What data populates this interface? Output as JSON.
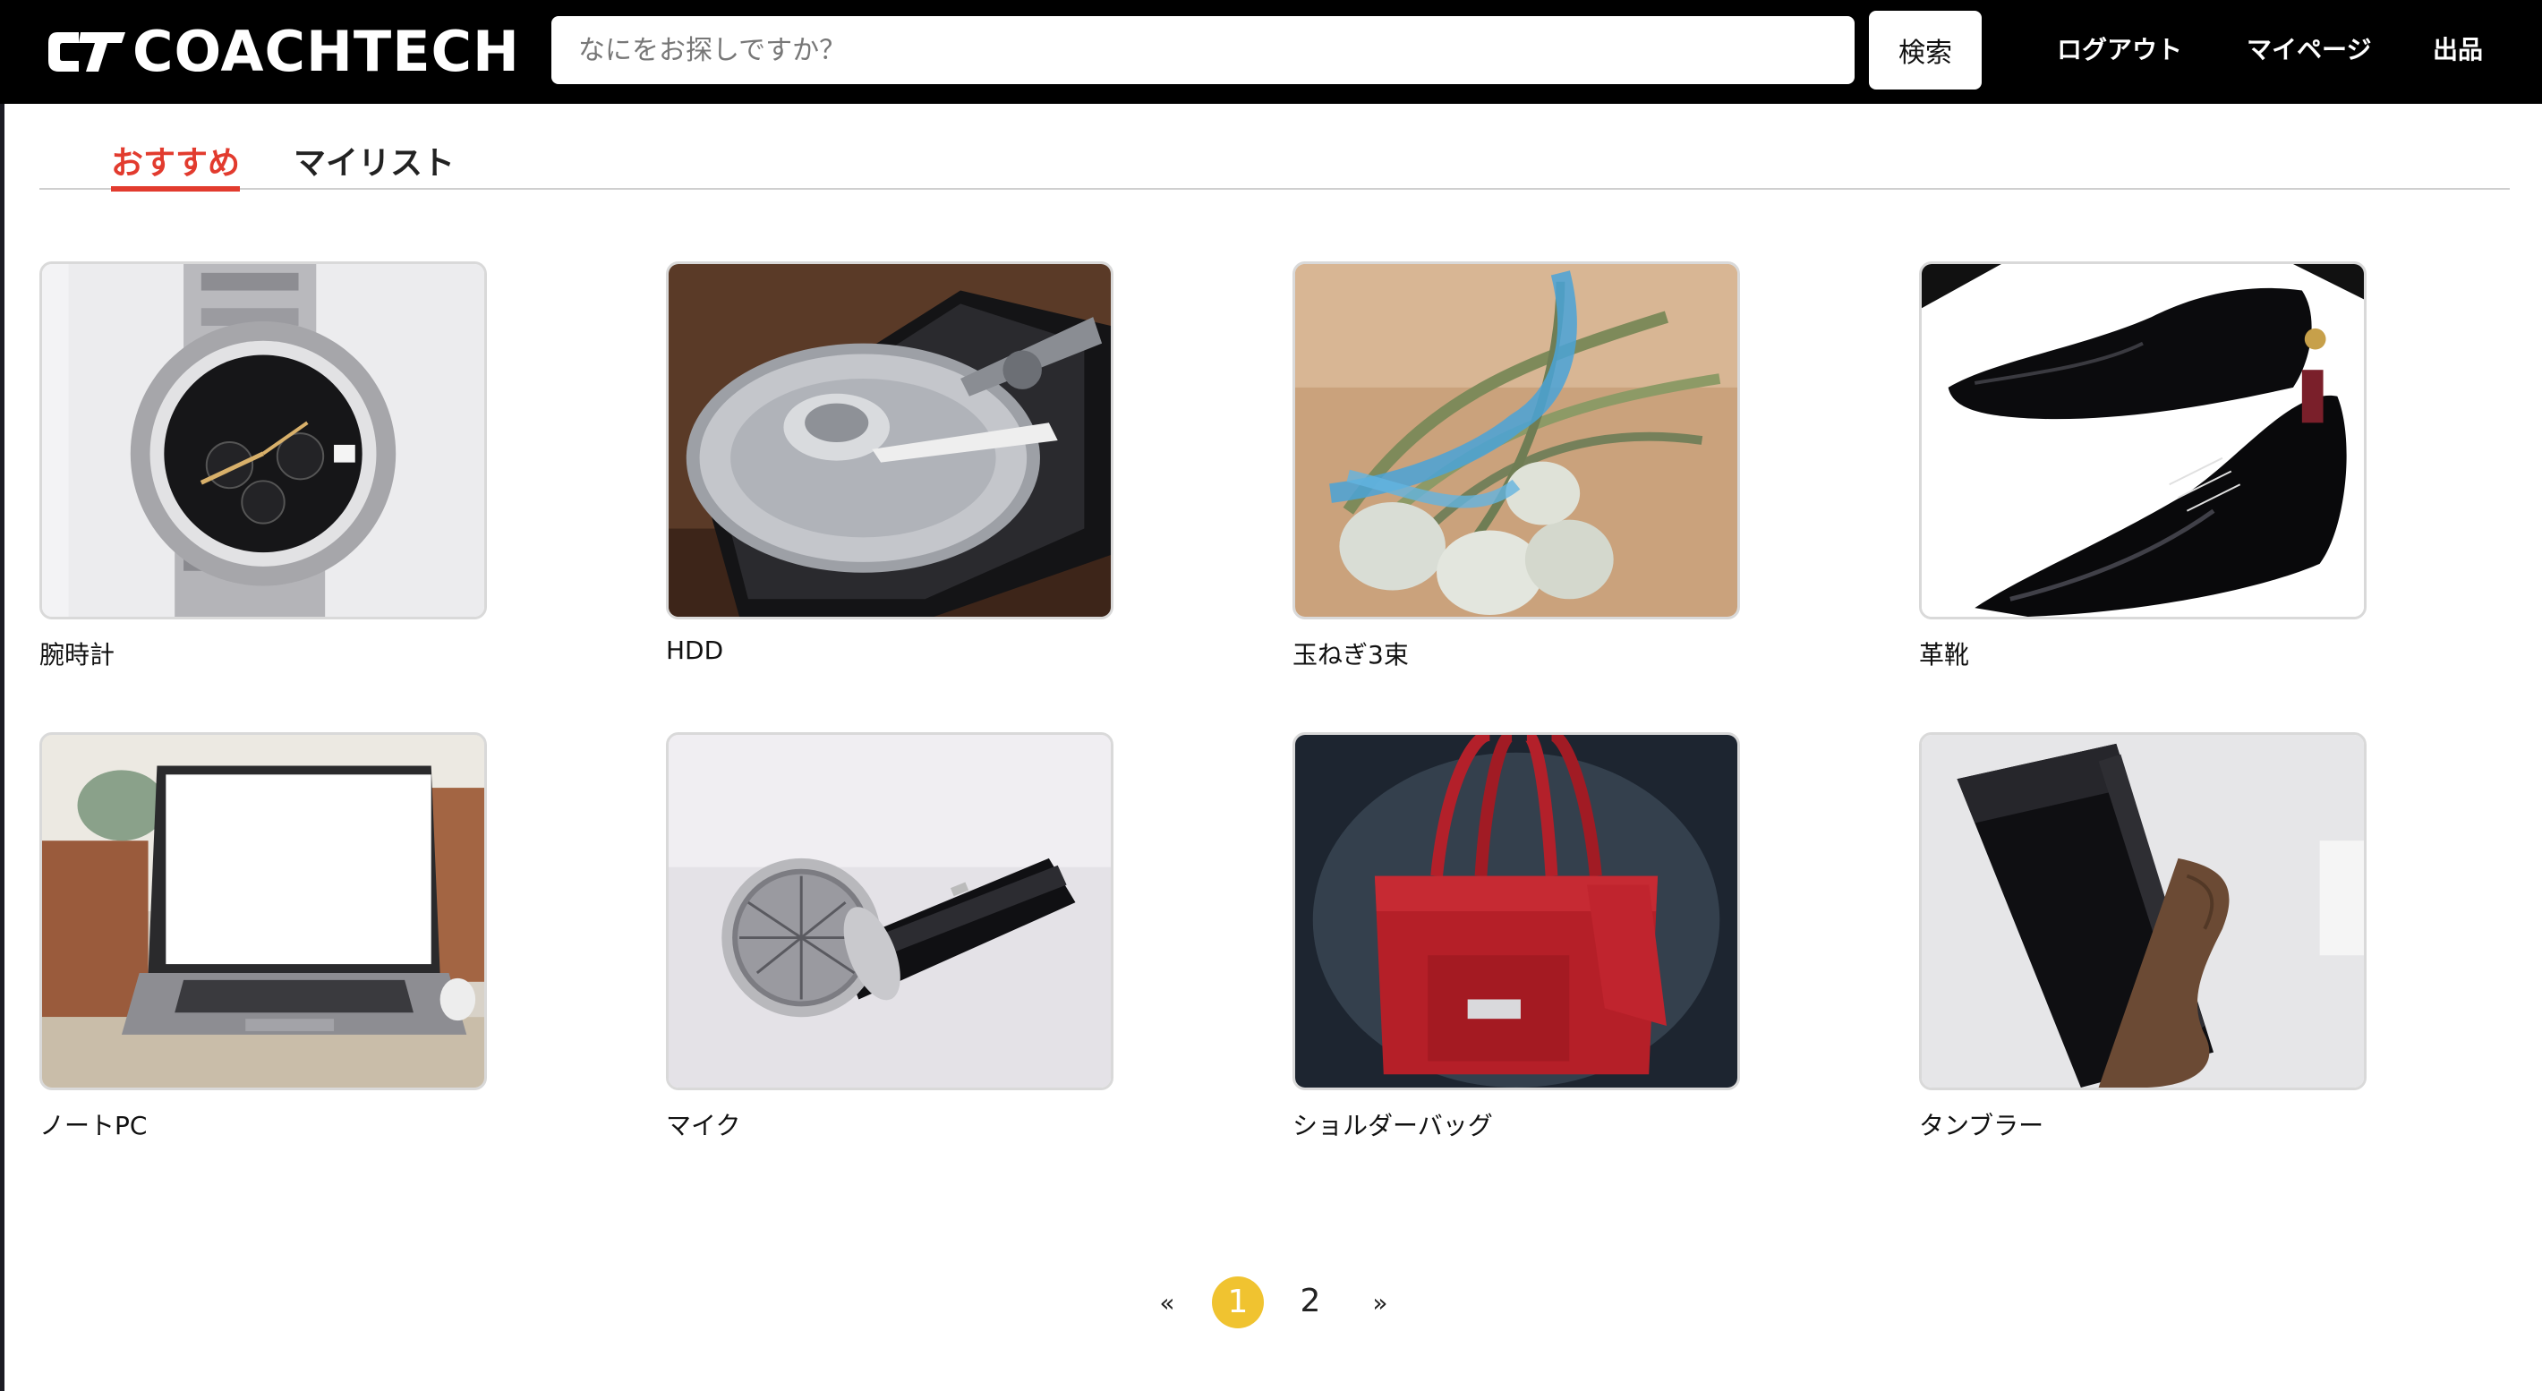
{
  "header": {
    "logo_mark": "CT",
    "logo_text": "COACHTECH",
    "search_placeholder": "なにをお探しですか？",
    "search_button": "検索",
    "nav": {
      "logout": "ログアウト",
      "mypage": "マイページ",
      "sell": "出品"
    }
  },
  "tabs": [
    {
      "label": "おすすめ",
      "active": true
    },
    {
      "label": "マイリスト",
      "active": false
    }
  ],
  "colors": {
    "accent": "#e23b2e",
    "page_current": "#f0c330",
    "header_bg": "#000000"
  },
  "items": [
    {
      "name": "腕時計",
      "image_icon": "wristwatch-photo"
    },
    {
      "name": "HDD",
      "image_icon": "hard-drive-photo"
    },
    {
      "name": "玉ねぎ3束",
      "image_icon": "onions-photo"
    },
    {
      "name": "革靴",
      "image_icon": "leather-shoes-photo"
    },
    {
      "name": "ノートPC",
      "image_icon": "laptop-photo"
    },
    {
      "name": "マイク",
      "image_icon": "microphone-photo"
    },
    {
      "name": "ショルダーバッグ",
      "image_icon": "shoulder-bag-photo"
    },
    {
      "name": "タンブラー",
      "image_icon": "tumbler-photo"
    }
  ],
  "pagination": {
    "prev": "«",
    "pages": [
      "1",
      "2"
    ],
    "current": "1",
    "next": "»"
  }
}
